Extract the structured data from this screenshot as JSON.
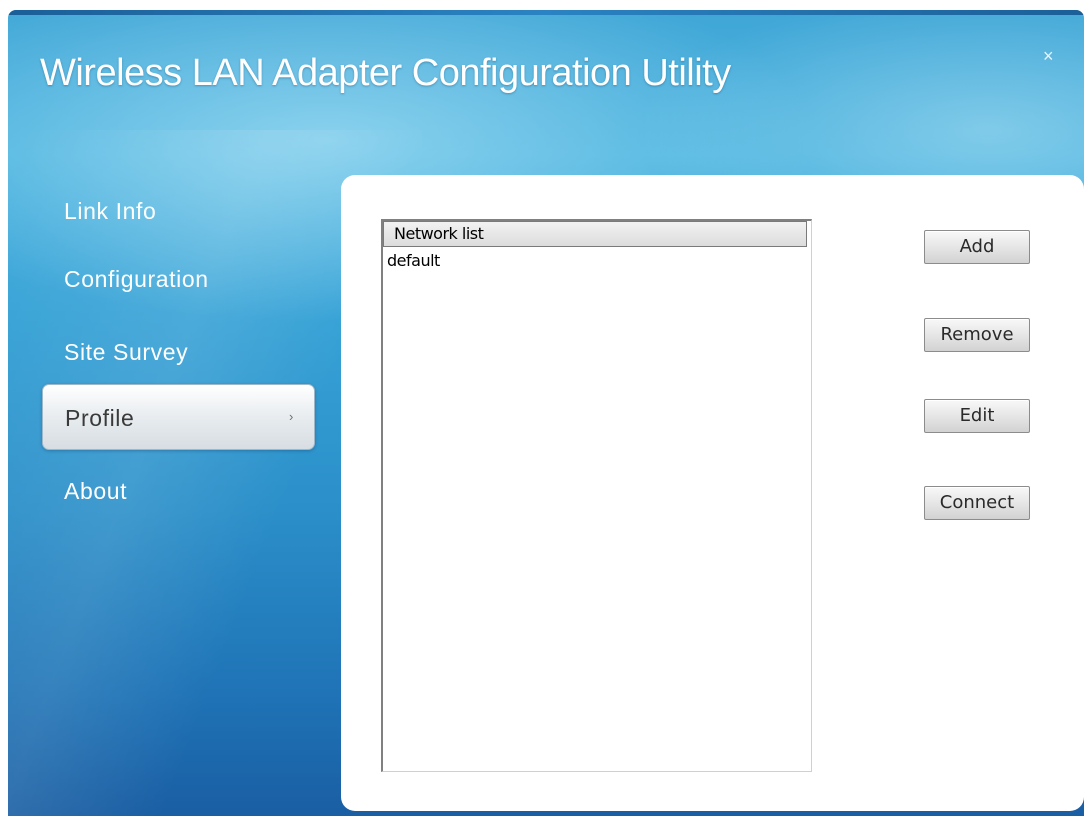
{
  "window": {
    "title": "Wireless LAN Adapter Configuration Utility",
    "close_glyph": "×"
  },
  "sidebar": {
    "items": [
      {
        "label": "Link Info",
        "active": false
      },
      {
        "label": "Configuration",
        "active": false
      },
      {
        "label": "Site Survey",
        "active": false
      },
      {
        "label": "Profile",
        "active": true
      },
      {
        "label": "About",
        "active": false
      }
    ],
    "active_arrow": "›"
  },
  "profile": {
    "list_header": "Network list",
    "rows": [
      "default"
    ],
    "buttons": {
      "add": "Add",
      "remove": "Remove",
      "edit": "Edit",
      "connect": "Connect"
    }
  },
  "colors": {
    "accent": "#2b8fc9",
    "panel": "#ffffff"
  },
  "icons": {
    "close": "close-icon",
    "arrow": "chevron-right-icon"
  }
}
